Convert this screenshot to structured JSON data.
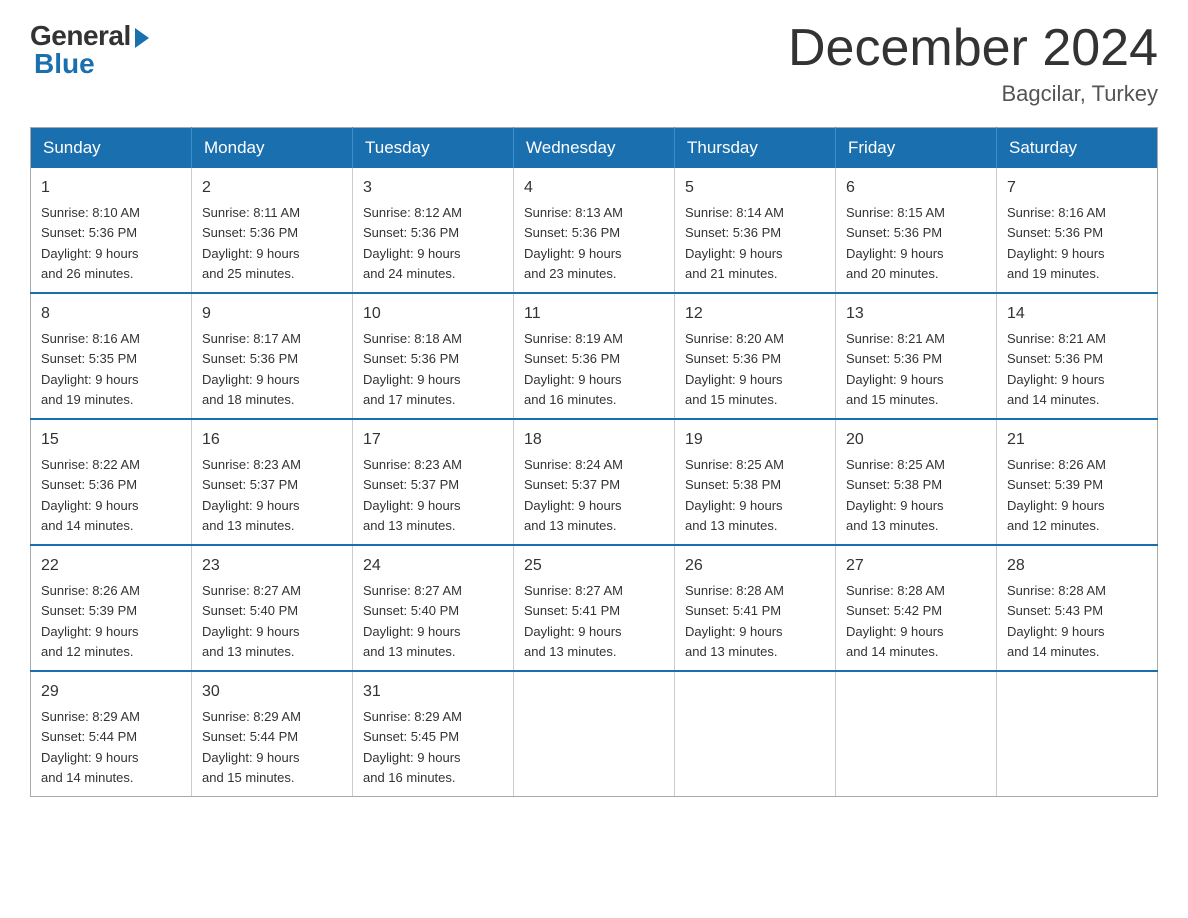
{
  "logo": {
    "general": "General",
    "blue": "Blue"
  },
  "header": {
    "month_title": "December 2024",
    "location": "Bagcilar, Turkey"
  },
  "weekdays": [
    "Sunday",
    "Monday",
    "Tuesday",
    "Wednesday",
    "Thursday",
    "Friday",
    "Saturday"
  ],
  "weeks": [
    [
      {
        "day": "1",
        "sunrise": "8:10 AM",
        "sunset": "5:36 PM",
        "daylight": "9 hours and 26 minutes."
      },
      {
        "day": "2",
        "sunrise": "8:11 AM",
        "sunset": "5:36 PM",
        "daylight": "9 hours and 25 minutes."
      },
      {
        "day": "3",
        "sunrise": "8:12 AM",
        "sunset": "5:36 PM",
        "daylight": "9 hours and 24 minutes."
      },
      {
        "day": "4",
        "sunrise": "8:13 AM",
        "sunset": "5:36 PM",
        "daylight": "9 hours and 23 minutes."
      },
      {
        "day": "5",
        "sunrise": "8:14 AM",
        "sunset": "5:36 PM",
        "daylight": "9 hours and 21 minutes."
      },
      {
        "day": "6",
        "sunrise": "8:15 AM",
        "sunset": "5:36 PM",
        "daylight": "9 hours and 20 minutes."
      },
      {
        "day": "7",
        "sunrise": "8:16 AM",
        "sunset": "5:36 PM",
        "daylight": "9 hours and 19 minutes."
      }
    ],
    [
      {
        "day": "8",
        "sunrise": "8:16 AM",
        "sunset": "5:35 PM",
        "daylight": "9 hours and 19 minutes."
      },
      {
        "day": "9",
        "sunrise": "8:17 AM",
        "sunset": "5:36 PM",
        "daylight": "9 hours and 18 minutes."
      },
      {
        "day": "10",
        "sunrise": "8:18 AM",
        "sunset": "5:36 PM",
        "daylight": "9 hours and 17 minutes."
      },
      {
        "day": "11",
        "sunrise": "8:19 AM",
        "sunset": "5:36 PM",
        "daylight": "9 hours and 16 minutes."
      },
      {
        "day": "12",
        "sunrise": "8:20 AM",
        "sunset": "5:36 PM",
        "daylight": "9 hours and 15 minutes."
      },
      {
        "day": "13",
        "sunrise": "8:21 AM",
        "sunset": "5:36 PM",
        "daylight": "9 hours and 15 minutes."
      },
      {
        "day": "14",
        "sunrise": "8:21 AM",
        "sunset": "5:36 PM",
        "daylight": "9 hours and 14 minutes."
      }
    ],
    [
      {
        "day": "15",
        "sunrise": "8:22 AM",
        "sunset": "5:36 PM",
        "daylight": "9 hours and 14 minutes."
      },
      {
        "day": "16",
        "sunrise": "8:23 AM",
        "sunset": "5:37 PM",
        "daylight": "9 hours and 13 minutes."
      },
      {
        "day": "17",
        "sunrise": "8:23 AM",
        "sunset": "5:37 PM",
        "daylight": "9 hours and 13 minutes."
      },
      {
        "day": "18",
        "sunrise": "8:24 AM",
        "sunset": "5:37 PM",
        "daylight": "9 hours and 13 minutes."
      },
      {
        "day": "19",
        "sunrise": "8:25 AM",
        "sunset": "5:38 PM",
        "daylight": "9 hours and 13 minutes."
      },
      {
        "day": "20",
        "sunrise": "8:25 AM",
        "sunset": "5:38 PM",
        "daylight": "9 hours and 13 minutes."
      },
      {
        "day": "21",
        "sunrise": "8:26 AM",
        "sunset": "5:39 PM",
        "daylight": "9 hours and 12 minutes."
      }
    ],
    [
      {
        "day": "22",
        "sunrise": "8:26 AM",
        "sunset": "5:39 PM",
        "daylight": "9 hours and 12 minutes."
      },
      {
        "day": "23",
        "sunrise": "8:27 AM",
        "sunset": "5:40 PM",
        "daylight": "9 hours and 13 minutes."
      },
      {
        "day": "24",
        "sunrise": "8:27 AM",
        "sunset": "5:40 PM",
        "daylight": "9 hours and 13 minutes."
      },
      {
        "day": "25",
        "sunrise": "8:27 AM",
        "sunset": "5:41 PM",
        "daylight": "9 hours and 13 minutes."
      },
      {
        "day": "26",
        "sunrise": "8:28 AM",
        "sunset": "5:41 PM",
        "daylight": "9 hours and 13 minutes."
      },
      {
        "day": "27",
        "sunrise": "8:28 AM",
        "sunset": "5:42 PM",
        "daylight": "9 hours and 14 minutes."
      },
      {
        "day": "28",
        "sunrise": "8:28 AM",
        "sunset": "5:43 PM",
        "daylight": "9 hours and 14 minutes."
      }
    ],
    [
      {
        "day": "29",
        "sunrise": "8:29 AM",
        "sunset": "5:44 PM",
        "daylight": "9 hours and 14 minutes."
      },
      {
        "day": "30",
        "sunrise": "8:29 AM",
        "sunset": "5:44 PM",
        "daylight": "9 hours and 15 minutes."
      },
      {
        "day": "31",
        "sunrise": "8:29 AM",
        "sunset": "5:45 PM",
        "daylight": "9 hours and 16 minutes."
      },
      null,
      null,
      null,
      null
    ]
  ],
  "labels": {
    "sunrise": "Sunrise:",
    "sunset": "Sunset:",
    "daylight": "Daylight:"
  }
}
